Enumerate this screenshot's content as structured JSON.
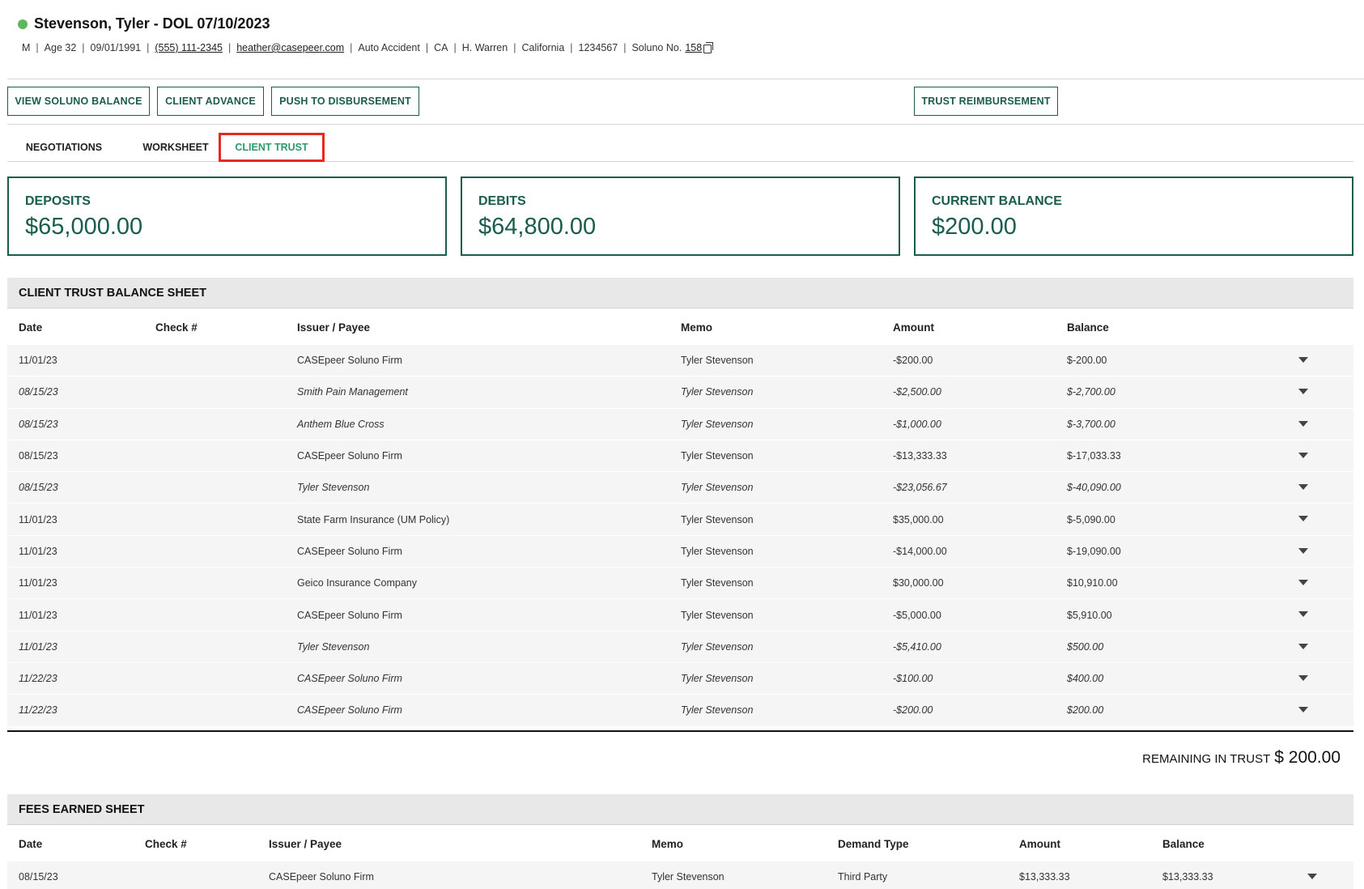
{
  "client": {
    "title": "Stevenson, Tyler - DOL 07/10/2023",
    "status_color": "#5cb85c",
    "meta": {
      "gender": "M",
      "age": "Age 32",
      "dob": "09/01/1991",
      "phone": "(555) 111-2345",
      "email": "heather@casepeer.com",
      "case_type": "Auto Accident",
      "state_code": "CA",
      "attorney": "H. Warren",
      "state": "California",
      "case_number": "1234567",
      "soluno_label": "Soluno No.",
      "soluno_no": "158"
    }
  },
  "actions": {
    "view_soluno_balance": "VIEW SOLUNO BALANCE",
    "client_advance": "CLIENT ADVANCE",
    "push_to_disbursement": "PUSH TO DISBURSEMENT",
    "trust_reimbursement": "TRUST REIMBURSEMENT"
  },
  "tabs": {
    "negotiations": "NEGOTIATIONS",
    "worksheet": "WORKSHEET",
    "client_trust": "CLIENT TRUST",
    "active": "client_trust"
  },
  "summary": {
    "deposits": {
      "label": "DEPOSITS",
      "value": "$65,000.00"
    },
    "debits": {
      "label": "DEBITS",
      "value": "$64,800.00"
    },
    "current_balance": {
      "label": "CURRENT BALANCE",
      "value": "$200.00"
    }
  },
  "trust_sheet": {
    "title": "CLIENT TRUST BALANCE SHEET",
    "columns": {
      "date": "Date",
      "check": "Check #",
      "payee": "Issuer / Payee",
      "memo": "Memo",
      "amount": "Amount",
      "balance": "Balance"
    },
    "rows": [
      {
        "date": "11/01/23",
        "check": "",
        "payee": "CASEpeer Soluno Firm",
        "memo": "Tyler Stevenson",
        "amount": "-$200.00",
        "balance": "$-200.00",
        "italic": false
      },
      {
        "date": "08/15/23",
        "check": "",
        "payee": "Smith Pain Management",
        "memo": "Tyler Stevenson",
        "amount": "-$2,500.00",
        "balance": "$-2,700.00",
        "italic": true
      },
      {
        "date": "08/15/23",
        "check": "",
        "payee": "Anthem Blue Cross",
        "memo": "Tyler Stevenson",
        "amount": "-$1,000.00",
        "balance": "$-3,700.00",
        "italic": true
      },
      {
        "date": "08/15/23",
        "check": "",
        "payee": "CASEpeer Soluno Firm",
        "memo": "Tyler Stevenson",
        "amount": "-$13,333.33",
        "balance": "$-17,033.33",
        "italic": false
      },
      {
        "date": "08/15/23",
        "check": "",
        "payee": "Tyler Stevenson",
        "memo": "Tyler Stevenson",
        "amount": "-$23,056.67",
        "balance": "$-40,090.00",
        "italic": true
      },
      {
        "date": "11/01/23",
        "check": "",
        "payee": "State Farm Insurance (UM Policy)",
        "memo": "Tyler Stevenson",
        "amount": "$35,000.00",
        "balance": "$-5,090.00",
        "italic": false
      },
      {
        "date": "11/01/23",
        "check": "",
        "payee": "CASEpeer Soluno Firm",
        "memo": "Tyler Stevenson",
        "amount": "-$14,000.00",
        "balance": "$-19,090.00",
        "italic": false
      },
      {
        "date": "11/01/23",
        "check": "",
        "payee": "Geico Insurance Company",
        "memo": "Tyler Stevenson",
        "amount": "$30,000.00",
        "balance": "$10,910.00",
        "italic": false
      },
      {
        "date": "11/01/23",
        "check": "",
        "payee": "CASEpeer Soluno Firm",
        "memo": "Tyler Stevenson",
        "amount": "-$5,000.00",
        "balance": "$5,910.00",
        "italic": false
      },
      {
        "date": "11/01/23",
        "check": "",
        "payee": "Tyler Stevenson",
        "memo": "Tyler Stevenson",
        "amount": "-$5,410.00",
        "balance": "$500.00",
        "italic": true
      },
      {
        "date": "11/22/23",
        "check": "",
        "payee": "CASEpeer Soluno Firm",
        "memo": "Tyler Stevenson",
        "amount": "-$100.00",
        "balance": "$400.00",
        "italic": true
      },
      {
        "date": "11/22/23",
        "check": "",
        "payee": "CASEpeer Soluno Firm",
        "memo": "Tyler Stevenson",
        "amount": "-$200.00",
        "balance": "$200.00",
        "italic": true
      }
    ],
    "remaining_label": "REMAINING IN TRUST",
    "remaining_value": "$ 200.00"
  },
  "fees_sheet": {
    "title": "FEES EARNED SHEET",
    "columns": {
      "date": "Date",
      "check": "Check #",
      "payee": "Issuer / Payee",
      "memo": "Memo",
      "demand_type": "Demand Type",
      "amount": "Amount",
      "balance": "Balance"
    },
    "rows": [
      {
        "date": "08/15/23",
        "check": "",
        "payee": "CASEpeer Soluno Firm",
        "memo": "Tyler Stevenson",
        "demand_type": "Third Party",
        "amount": "$13,333.33",
        "balance": "$13,333.33"
      }
    ]
  }
}
